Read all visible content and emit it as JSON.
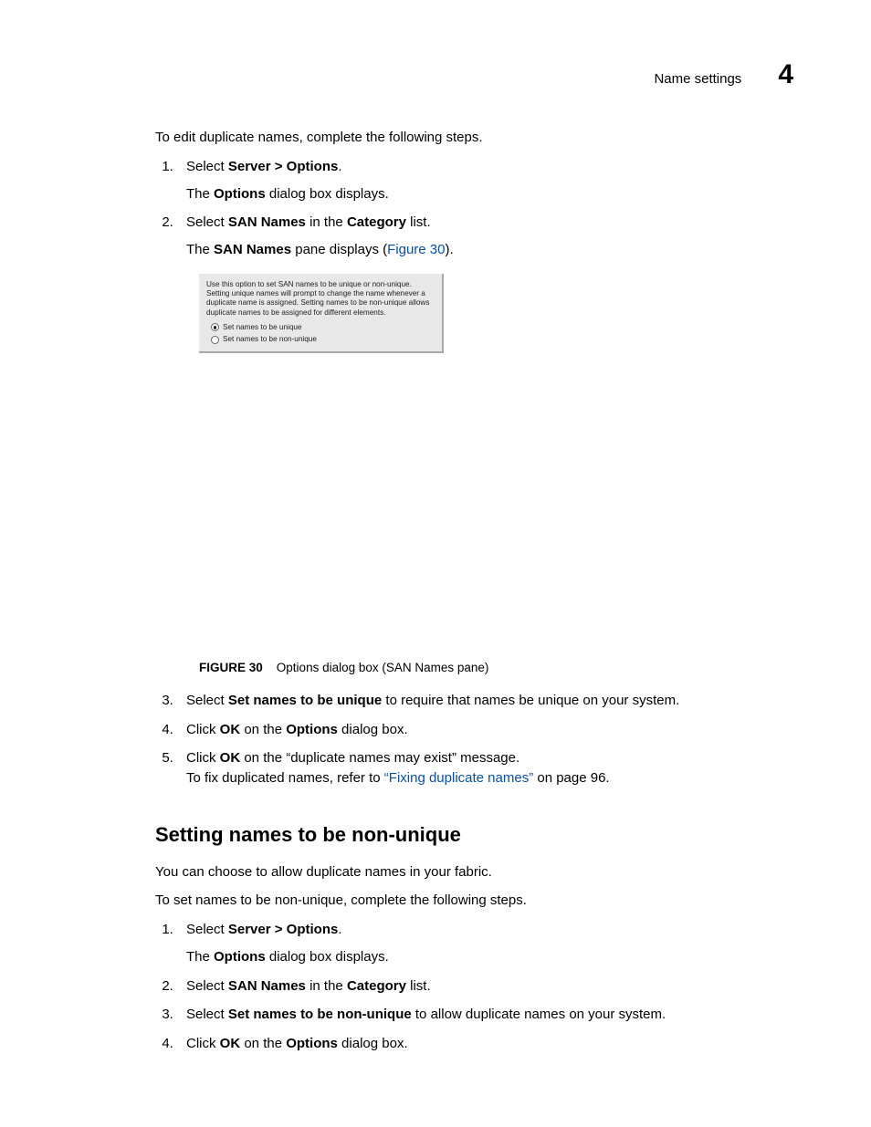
{
  "header": {
    "title": "Name settings",
    "chapter": "4"
  },
  "sectionA": {
    "intro": "To edit duplicate names, complete the following steps.",
    "step1_a": "Select ",
    "step1_b": "Server > Options",
    "step1_c": ".",
    "step1_sub_a": "The ",
    "step1_sub_b": "Options",
    "step1_sub_c": " dialog box displays.",
    "step2_a": "Select ",
    "step2_b": "SAN Names",
    "step2_c": " in the ",
    "step2_d": "Category",
    "step2_e": " list.",
    "step2_sub_a": "The ",
    "step2_sub_b": "SAN Names",
    "step2_sub_c": " pane displays (",
    "step2_sub_link": "Figure 30",
    "step2_sub_d": ").",
    "step3_a": "Select ",
    "step3_b": "Set names to be unique",
    "step3_c": " to require that names be unique on your system.",
    "step4_a": "Click ",
    "step4_b": "OK",
    "step4_c": " on the ",
    "step4_d": "Options",
    "step4_e": " dialog box.",
    "step5_a": "Click ",
    "step5_b": "OK",
    "step5_c": " on the “duplicate names may exist” message.",
    "step5_sub_a": "To fix duplicated names, refer to ",
    "step5_sub_link": "“Fixing duplicate names”",
    "step5_sub_b": " on page 96."
  },
  "dialog": {
    "desc": "Use this option to set SAN names to be unique or non-unique. Setting unique names will prompt to change the name whenever a duplicate name is assigned. Setting names to be non-unique allows duplicate names to be assigned for different elements.",
    "radio1": "Set names to be unique",
    "radio2": "Set names to be non-unique"
  },
  "figCaption": {
    "label": "FIGURE 30",
    "text": "Options dialog box (SAN Names pane)"
  },
  "sectionB": {
    "heading": "Setting names to be non-unique",
    "p1": "You can choose to allow duplicate names in your fabric.",
    "p2": "To set names to be non-unique, complete the following steps.",
    "step1_a": "Select ",
    "step1_b": "Server > Options",
    "step1_c": ".",
    "step1_sub_a": "The ",
    "step1_sub_b": "Options",
    "step1_sub_c": " dialog box displays.",
    "step2_a": "Select ",
    "step2_b": "SAN Names",
    "step2_c": " in the ",
    "step2_d": "Category",
    "step2_e": " list.",
    "step3_a": "Select ",
    "step3_b": "Set names to be non-unique",
    "step3_c": " to allow duplicate names on your system.",
    "step4_a": "Click ",
    "step4_b": "OK",
    "step4_c": " on the ",
    "step4_d": "Options",
    "step4_e": " dialog box."
  }
}
